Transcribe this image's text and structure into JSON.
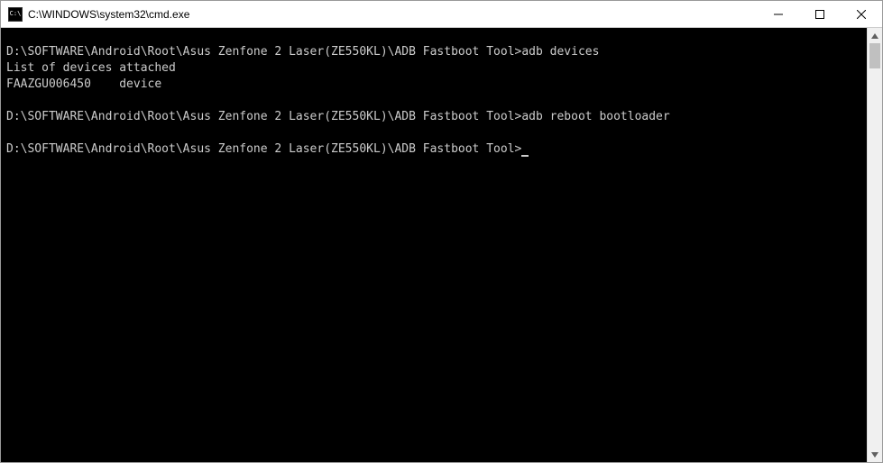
{
  "titlebar": {
    "icon_label": "C:\\",
    "title": "C:\\WINDOWS\\system32\\cmd.exe"
  },
  "terminal": {
    "lines": [
      "D:\\SOFTWARE\\Android\\Root\\Asus Zenfone 2 Laser(ZE550KL)\\ADB Fastboot Tool>adb devices",
      "List of devices attached",
      "FAAZGU006450    device",
      "",
      "D:\\SOFTWARE\\Android\\Root\\Asus Zenfone 2 Laser(ZE550KL)\\ADB Fastboot Tool>adb reboot bootloader",
      "",
      "D:\\SOFTWARE\\Android\\Root\\Asus Zenfone 2 Laser(ZE550KL)\\ADB Fastboot Tool>"
    ]
  }
}
